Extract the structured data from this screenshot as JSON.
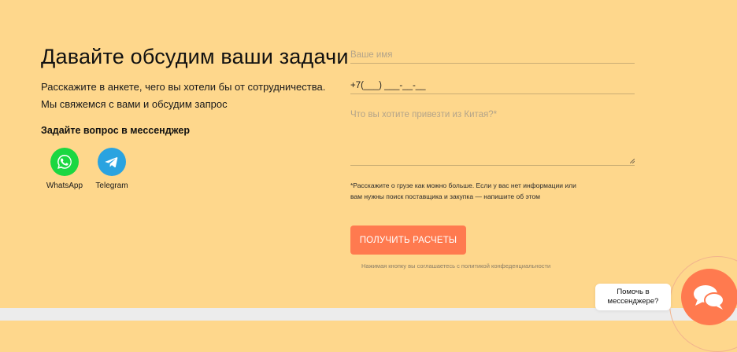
{
  "contact": {
    "title": "Давайте обсудим ваши задачи",
    "description": "Расскажите в анкете, чего вы хотели бы от сотрудничества. Мы свяжемся с вами и обсудим запрос",
    "ask_label": "Задайте вопрос в мессенджер",
    "messengers": [
      {
        "label": "WhatsApp",
        "icon": "whatsapp-icon",
        "color": "#1bd741"
      },
      {
        "label": "Telegram",
        "icon": "telegram-icon",
        "color": "#2aa3e0"
      }
    ]
  },
  "form": {
    "name_placeholder": "Ваше имя",
    "phone_value": "+7(___) ___-__-__",
    "message_placeholder": "Что вы хотите привезти из Китая?*",
    "note": "*Расскажите о грузе как можно больше. Если у вас нет информации или вам нужны поиск поставщика и закупка — напишите об этом",
    "submit_label": "ПОЛУЧИТЬ РАСЧЕТЫ",
    "privacy": "Нажимая кнопку вы соглашаетесь с политикой конфеденциальности"
  },
  "help_widget": {
    "text": "Помочь в\nмессенджере?",
    "icon": "chat-bubbles-icon"
  },
  "colors": {
    "background": "#fed78c",
    "accent": "#ff7a4f",
    "footer": "#ececec"
  }
}
